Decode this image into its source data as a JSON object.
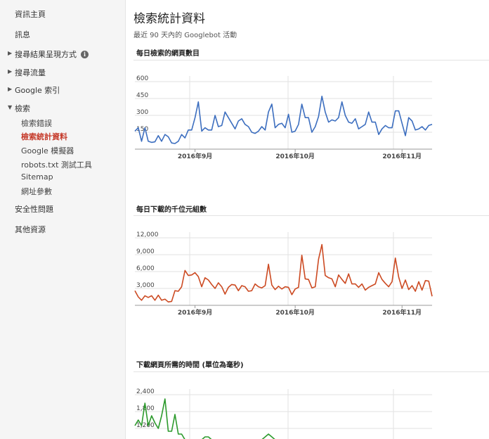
{
  "sidebar": {
    "items": [
      {
        "label": "資訊主頁",
        "arrow": ""
      },
      {
        "label": "訊息",
        "arrow": ""
      },
      {
        "label": "搜尋結果呈現方式",
        "arrow": "▶"
      },
      {
        "label": "搜尋流量",
        "arrow": "▶"
      },
      {
        "label": "Google 索引",
        "arrow": "▶"
      },
      {
        "label": "檢索",
        "arrow": "▼"
      }
    ],
    "info_icon": "i",
    "sub_items": [
      {
        "label": "檢索錯誤"
      },
      {
        "label": "檢索統計資料",
        "active": true
      },
      {
        "label": "Google 模擬器"
      },
      {
        "label": "robots.txt 測試工具"
      },
      {
        "label": "Sitemap"
      },
      {
        "label": "網址參數"
      }
    ],
    "bottom_items": [
      {
        "label": "安全性問題"
      },
      {
        "label": "其他資源"
      }
    ]
  },
  "main": {
    "title": "檢索統計資料",
    "subtitle": "最近 90 天內的 Googlebot 活動"
  },
  "colors": {
    "blue": "#3c6ebf",
    "red": "#cc4a22",
    "green": "#2c9a2c",
    "active": "#c53929"
  },
  "chart_data": [
    {
      "type": "line",
      "title": "每日檢索的網頁數目",
      "color": "#3c6ebf",
      "yticks": [
        "600",
        "450",
        "300",
        "150"
      ],
      "ytick_values": [
        600,
        450,
        300,
        150
      ],
      "ylim": [
        0,
        650
      ],
      "xticks": [
        "2016年9月",
        "2016年10月",
        "2016年11月"
      ],
      "xtick_index": [
        18,
        48,
        80
      ],
      "values": [
        160,
        190,
        70,
        190,
        70,
        60,
        65,
        120,
        70,
        130,
        110,
        55,
        50,
        70,
        130,
        100,
        170,
        170,
        280,
        420,
        160,
        190,
        170,
        170,
        300,
        200,
        210,
        330,
        280,
        230,
        180,
        250,
        270,
        220,
        200,
        150,
        140,
        160,
        200,
        170,
        330,
        400,
        190,
        220,
        230,
        190,
        310,
        150,
        160,
        220,
        400,
        280,
        280,
        150,
        200,
        290,
        470,
        330,
        240,
        260,
        250,
        280,
        420,
        300,
        240,
        230,
        270,
        180,
        200,
        220,
        330,
        240,
        240,
        130,
        180,
        210,
        190,
        190,
        340,
        340,
        230,
        120,
        280,
        250,
        170,
        180,
        200,
        170,
        210,
        220
      ]
    },
    {
      "type": "line",
      "title": "每日下載的千位元組數",
      "color": "#cc4a22",
      "yticks": [
        "12,000",
        "9,000",
        "6,000",
        "3,000"
      ],
      "ytick_values": [
        12000,
        9000,
        6000,
        3000
      ],
      "ylim": [
        0,
        13000
      ],
      "xticks": [
        "2016年9月",
        "2016年10月",
        "2016年11月"
      ],
      "xtick_index": [
        18,
        48,
        80
      ],
      "values": [
        2600,
        1500,
        900,
        1700,
        1400,
        1700,
        900,
        1800,
        900,
        1100,
        600,
        700,
        2600,
        2500,
        3300,
        6200,
        5300,
        5400,
        5800,
        5100,
        3300,
        4900,
        4500,
        3700,
        3000,
        4000,
        3300,
        2000,
        3200,
        3700,
        3600,
        2600,
        3500,
        3300,
        2500,
        2600,
        3800,
        3300,
        3100,
        3500,
        7300,
        3600,
        2800,
        3400,
        2900,
        3300,
        3200,
        1900,
        2900,
        3200,
        8900,
        4700,
        4600,
        3100,
        3300,
        8200,
        10800,
        5300,
        4900,
        4700,
        3300,
        5400,
        4600,
        3900,
        5600,
        3800,
        3800,
        3200,
        3800,
        2700,
        3200,
        3500,
        3800,
        5800,
        4600,
        3900,
        3300,
        4200,
        8400,
        5000,
        3000,
        4500,
        2800,
        3500,
        2500,
        4200,
        2700,
        4400,
        4300,
        1600
      ]
    },
    {
      "type": "line",
      "title": "下載網頁所需的時間 (單位為毫秒)",
      "color": "#2c9a2c",
      "yticks": [
        "2,400",
        "1,800",
        "1,200"
      ],
      "ytick_values": [
        2400,
        1800,
        1200
      ],
      "ylim": [
        0,
        2600
      ],
      "xticks": [],
      "xtick_index": [],
      "values": [
        1300,
        1500,
        1300,
        2100,
        1300,
        1650,
        1400,
        1200,
        1650,
        2250,
        1100,
        1100,
        1700,
        1000,
        1000,
        800,
        600,
        500,
        600,
        700,
        800,
        900,
        900,
        800,
        800,
        700,
        700,
        600,
        600,
        600,
        500,
        600,
        600,
        700,
        800,
        700,
        800,
        800,
        800,
        900,
        1000,
        900,
        800,
        700,
        600,
        600,
        500,
        500
      ]
    }
  ]
}
